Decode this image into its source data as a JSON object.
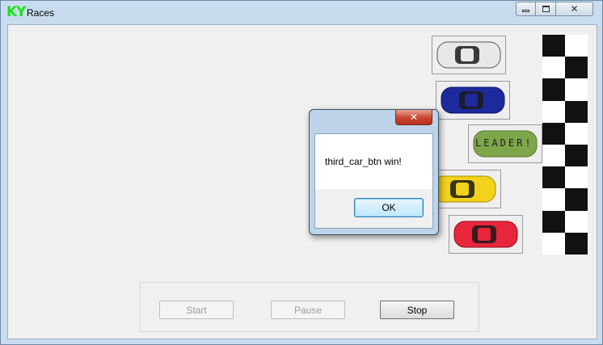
{
  "window": {
    "app_icon": "KY",
    "title": "Races",
    "caption_buttons": [
      "minimize-icon",
      "maximize-icon",
      "close-icon"
    ]
  },
  "cars": [
    {
      "name": "first-car-button",
      "color": "#e8e8e8",
      "accent": "#555555",
      "label": ""
    },
    {
      "name": "second-car-button",
      "color": "#1d2a9c",
      "accent": "#0c1460",
      "label": ""
    },
    {
      "name": "third-car-button",
      "color": "#7ea64a",
      "accent": "#55762f",
      "label": "LEADER!"
    },
    {
      "name": "fourth-car-button",
      "color": "#f2d21a",
      "accent": "#a88e00",
      "label": ""
    },
    {
      "name": "fifth-car-button",
      "color": "#e8253a",
      "accent": "#8d0f1c",
      "label": ""
    }
  ],
  "finish_line": {
    "colors": [
      "#111111",
      "#ffffff"
    ]
  },
  "controls": {
    "start_label": "Start",
    "pause_label": "Pause",
    "stop_label": "Stop",
    "start_enabled": false,
    "pause_enabled": false,
    "stop_enabled": true
  },
  "dialog": {
    "message": "third_car_btn win!",
    "ok_label": "OK",
    "close_icon": "close-icon"
  }
}
